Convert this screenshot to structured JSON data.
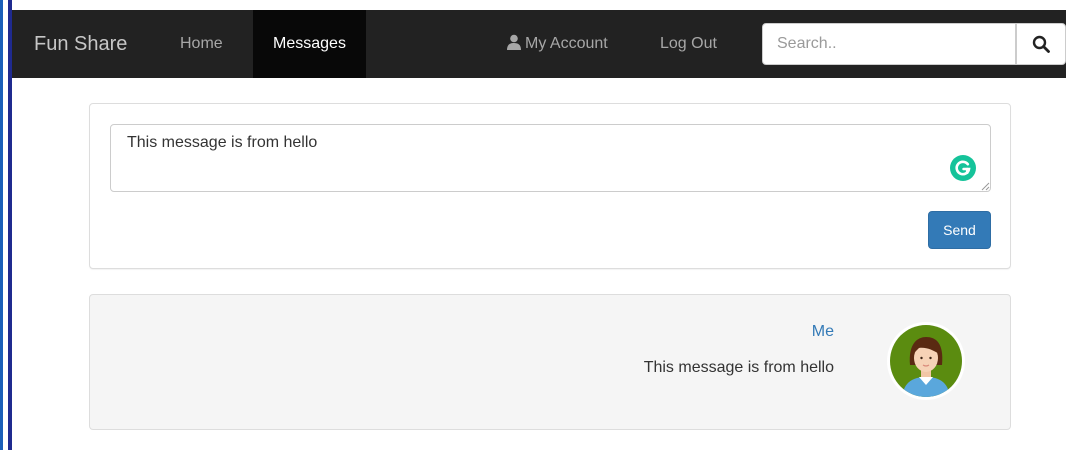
{
  "navbar": {
    "brand": "Fun Share",
    "links": {
      "home": "Home",
      "messages": "Messages",
      "account": "My Account",
      "logout": "Log Out"
    },
    "search": {
      "placeholder": "Search.."
    },
    "active_tab": "Messages"
  },
  "compose": {
    "text_value": "This message is from hello",
    "send_label": "Send"
  },
  "messages": [
    {
      "sender": "Me",
      "text": "This message is from hello"
    }
  ],
  "icons": {
    "account": "user-icon",
    "search": "search-icon",
    "grammar": "grammarly-icon",
    "avatar": "avatar"
  },
  "colors": {
    "navbar_bg": "#222222",
    "active_tab_bg": "#080808",
    "primary": "#337ab7",
    "grammarly": "#15c39a",
    "avatar_bg": "#5b8c10"
  }
}
